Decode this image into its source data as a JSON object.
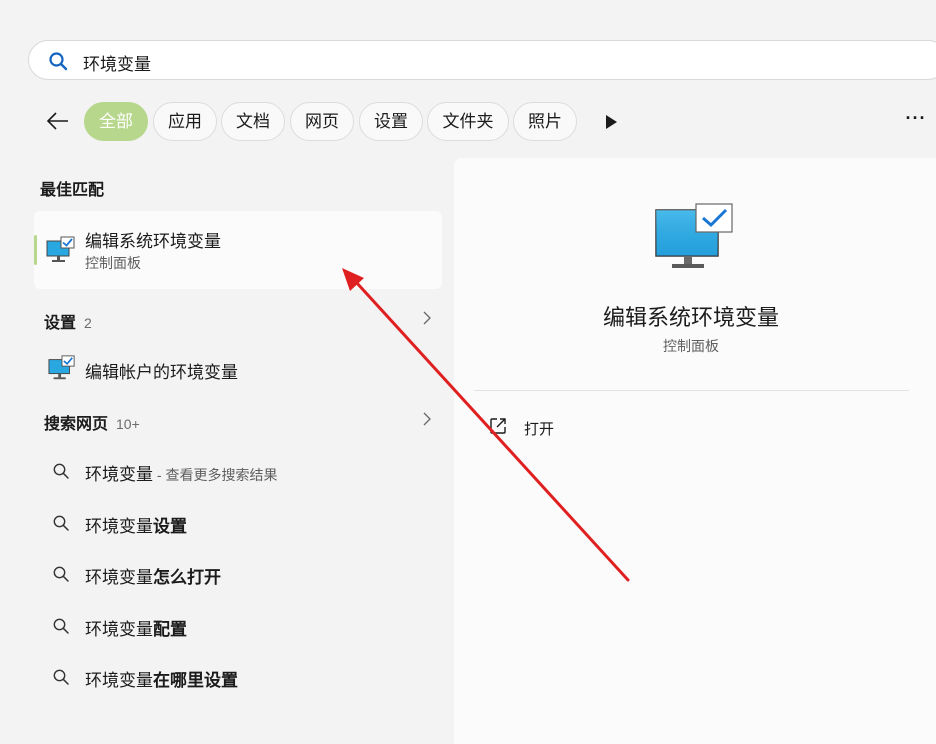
{
  "search": {
    "query": "环境变量"
  },
  "filters": {
    "back_icon": "arrow-left-icon",
    "chips": [
      {
        "label": "全部",
        "active": true
      },
      {
        "label": "应用",
        "active": false
      },
      {
        "label": "文档",
        "active": false
      },
      {
        "label": "网页",
        "active": false
      },
      {
        "label": "设置",
        "active": false
      },
      {
        "label": "文件夹",
        "active": false
      },
      {
        "label": "照片",
        "active": false
      }
    ],
    "play_icon": "play-icon",
    "more_label": "···"
  },
  "best_match": {
    "heading": "最佳匹配",
    "title": "编辑系统环境变量",
    "subtitle": "控制面板",
    "icon": "monitor-check-icon"
  },
  "settings_section": {
    "heading": "设置",
    "count": "2",
    "items": [
      {
        "label": "编辑帐户的环境变量",
        "icon": "monitor-check-icon"
      }
    ]
  },
  "web_section": {
    "heading": "搜索网页",
    "count": "10+",
    "items": [
      {
        "prefix": "环境变量",
        "suffix": " - 查看更多搜索结果",
        "bold": ""
      },
      {
        "prefix": "环境变量",
        "suffix": "",
        "bold": "设置"
      },
      {
        "prefix": "环境变量",
        "suffix": "",
        "bold": "怎么打开"
      },
      {
        "prefix": "环境变量",
        "suffix": "",
        "bold": "配置"
      },
      {
        "prefix": "环境变量",
        "suffix": "",
        "bold": "在哪里设置"
      }
    ]
  },
  "detail": {
    "title": "编辑系统环境变量",
    "subtitle": "控制面板",
    "icon": "monitor-check-icon",
    "actions": [
      {
        "label": "打开",
        "icon": "open-external-icon"
      }
    ]
  },
  "colors": {
    "accent": "#b7d88c",
    "annotation_arrow": "#e02020",
    "monitor_screen": "#29a7e1"
  }
}
